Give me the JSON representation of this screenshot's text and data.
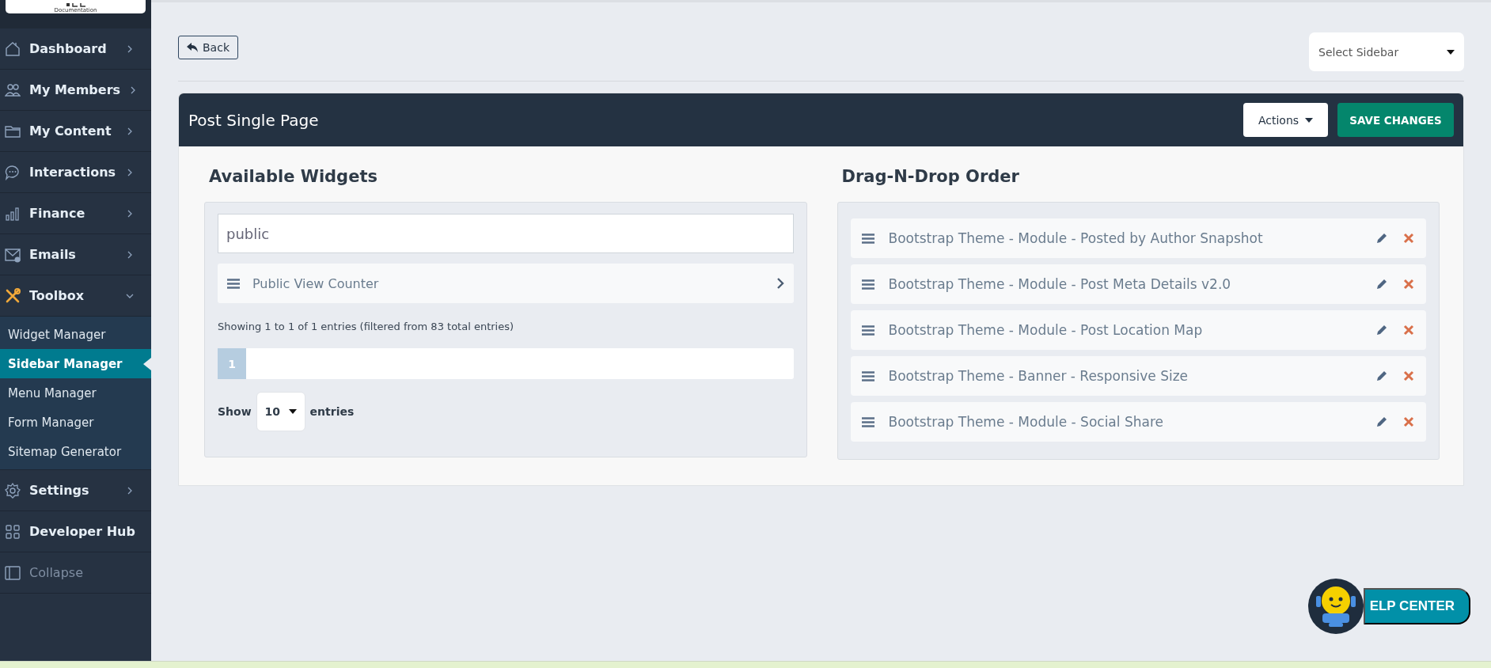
{
  "logo": {
    "caption": "Documentation"
  },
  "sidebar": {
    "items": [
      {
        "label": "Dashboard",
        "kind": "menu",
        "expanded": false
      },
      {
        "label": "My Members",
        "kind": "menu",
        "expanded": false
      },
      {
        "label": "My Content",
        "kind": "menu",
        "expanded": false
      },
      {
        "label": "Interactions",
        "kind": "menu",
        "expanded": false
      },
      {
        "label": "Finance",
        "kind": "menu",
        "expanded": false
      },
      {
        "label": "Emails",
        "kind": "menu",
        "expanded": false
      },
      {
        "label": "Toolbox",
        "kind": "menu",
        "expanded": true,
        "children": [
          {
            "label": "Widget Manager",
            "selected": false
          },
          {
            "label": "Sidebar Manager",
            "selected": true
          },
          {
            "label": "Menu Manager",
            "selected": false
          },
          {
            "label": "Form Manager",
            "selected": false
          },
          {
            "label": "Sitemap Generator",
            "selected": false
          }
        ]
      },
      {
        "label": "Settings",
        "kind": "menu",
        "expanded": false
      },
      {
        "label": "Developer Hub",
        "kind": "link"
      },
      {
        "label": "Collapse",
        "kind": "collapse"
      }
    ]
  },
  "toolbar": {
    "back_button": "Back",
    "sidebar_select": {
      "placeholder": "Select Sidebar"
    }
  },
  "card": {
    "title": "Post Single Page",
    "actions_button": "Actions",
    "save_button": "SAVE CHANGES"
  },
  "available_widgets": {
    "title": "Available Widgets",
    "search": {
      "value": "public"
    },
    "widgets": [
      {
        "label": "Public View Counter"
      }
    ],
    "info": "Showing 1 to 1 of 1 entries (filtered from 83 total entries)",
    "pages": [
      {
        "label": "1",
        "selected": true
      }
    ],
    "show_entries": {
      "before": "Show",
      "value": "10",
      "after": "entries"
    }
  },
  "order": {
    "title": "Drag-N-Drop Order",
    "items": [
      {
        "label": "Bootstrap Theme - Module - Posted by Author Snapshot"
      },
      {
        "label": "Bootstrap Theme - Module - Post Meta Details v2.0"
      },
      {
        "label": "Bootstrap Theme - Module - Post Location Map"
      },
      {
        "label": "Bootstrap Theme - Banner - Responsive Size"
      },
      {
        "label": "Bootstrap Theme - Module - Social Share"
      }
    ]
  },
  "help": {
    "label": "ELP CENTER"
  }
}
